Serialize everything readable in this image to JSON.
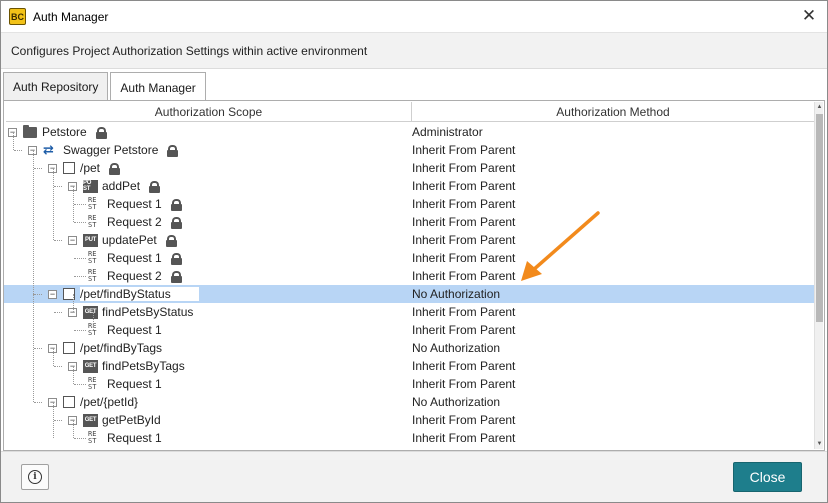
{
  "window": {
    "title": "Auth Manager",
    "close_glyph": "✕",
    "app_icon_text": "BC",
    "description": "Configures Project Authorization Settings within active environment"
  },
  "tabs": [
    {
      "label": "Auth Repository",
      "active": false
    },
    {
      "label": "Auth Manager",
      "active": true
    }
  ],
  "grid": {
    "headers": {
      "scope": "Authorization Scope",
      "method": "Authorization Method"
    },
    "rows": [
      {
        "label": "Petstore",
        "icon": "folder-icon",
        "level": 0,
        "locked": true,
        "method": "Administrator",
        "selected": false
      },
      {
        "label": "Swagger Petstore",
        "icon": "service-icon",
        "level": 1,
        "locked": true,
        "method": "Inherit From Parent",
        "selected": false
      },
      {
        "label": "/pet",
        "icon": "resource-icon",
        "level": 2,
        "locked": true,
        "method": "Inherit From Parent",
        "selected": false
      },
      {
        "label": "addPet",
        "icon": "post-method-icon",
        "level": 3,
        "locked": true,
        "method": "Inherit From Parent",
        "selected": false
      },
      {
        "label": "Request 1",
        "icon": "rest-request-icon",
        "level": 4,
        "locked": true,
        "method": "Inherit From Parent",
        "selected": false
      },
      {
        "label": "Request 2",
        "icon": "rest-request-icon",
        "level": 4,
        "locked": true,
        "method": "Inherit From Parent",
        "selected": false
      },
      {
        "label": "updatePet",
        "icon": "put-method-icon",
        "level": 3,
        "locked": true,
        "method": "Inherit From Parent",
        "selected": false
      },
      {
        "label": "Request 1",
        "icon": "rest-request-icon",
        "level": 4,
        "locked": true,
        "method": "Inherit From Parent",
        "selected": false
      },
      {
        "label": "Request 2",
        "icon": "rest-request-icon",
        "level": 4,
        "locked": true,
        "method": "Inherit From Parent",
        "selected": false
      },
      {
        "label": "/pet/findByStatus",
        "icon": "resource-icon",
        "level": 2,
        "locked": false,
        "method": "No Authorization",
        "selected": true
      },
      {
        "label": "findPetsByStatus",
        "icon": "get-method-icon",
        "level": 3,
        "locked": false,
        "method": "Inherit From Parent",
        "selected": false
      },
      {
        "label": "Request 1",
        "icon": "rest-request-icon",
        "level": 4,
        "locked": false,
        "method": "Inherit From Parent",
        "selected": false
      },
      {
        "label": "/pet/findByTags",
        "icon": "resource-icon",
        "level": 2,
        "locked": false,
        "method": "No Authorization",
        "selected": false
      },
      {
        "label": "findPetsByTags",
        "icon": "get-method-icon",
        "level": 3,
        "locked": false,
        "method": "Inherit From Parent",
        "selected": false
      },
      {
        "label": "Request 1",
        "icon": "rest-request-icon",
        "level": 4,
        "locked": false,
        "method": "Inherit From Parent",
        "selected": false
      },
      {
        "label": "/pet/{petId}",
        "icon": "resource-icon",
        "level": 2,
        "locked": false,
        "method": "No Authorization",
        "selected": false
      },
      {
        "label": "getPetById",
        "icon": "get-method-icon",
        "level": 3,
        "locked": false,
        "method": "Inherit From Parent",
        "selected": false
      },
      {
        "label": "Request 1",
        "icon": "rest-request-icon",
        "level": 4,
        "locked": false,
        "method": "Inherit From Parent",
        "selected": false
      }
    ]
  },
  "icon_text": {
    "post": "PO ST",
    "put": "PUT",
    "get": "GET",
    "rest_top": "RE",
    "rest_bottom": "ST"
  },
  "footer": {
    "info_glyph": "i",
    "close_label": "Close"
  },
  "colors": {
    "accent": "#1e7e8c",
    "selection": "#b8d5f5",
    "annotation_arrow": "#f28a1c"
  }
}
